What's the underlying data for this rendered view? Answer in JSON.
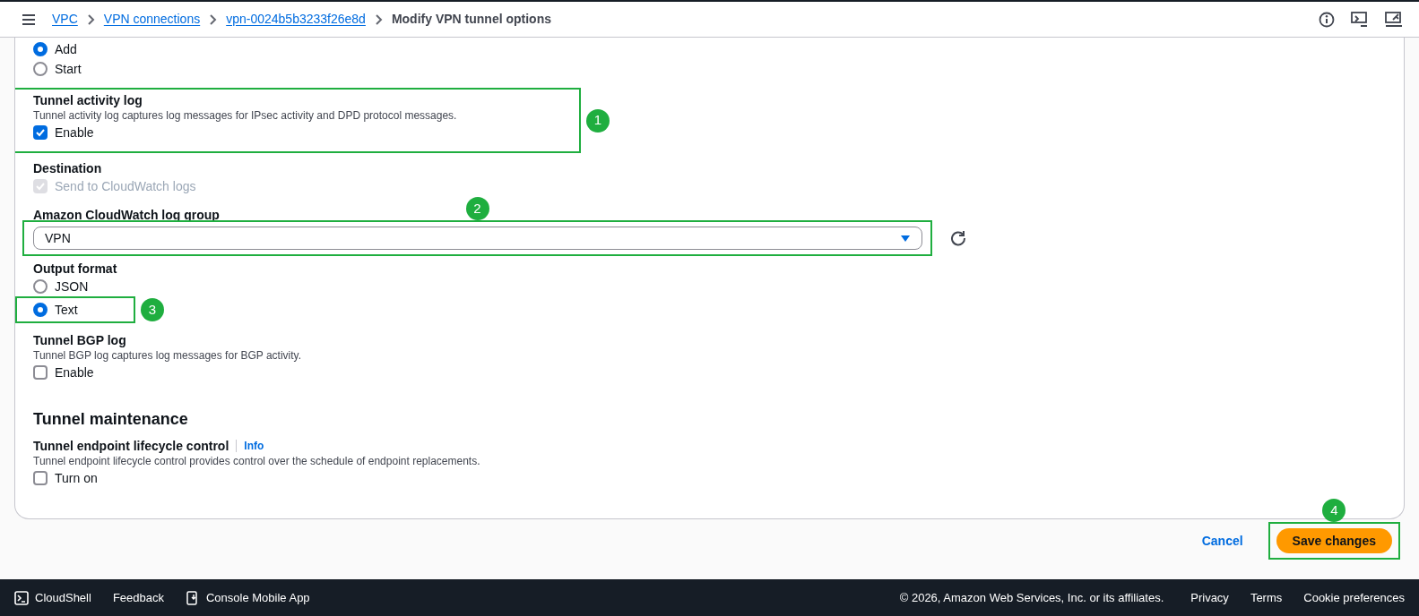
{
  "breadcrumb": [
    {
      "label": "VPC",
      "kind": "link"
    },
    {
      "label": "VPN connections",
      "kind": "link"
    },
    {
      "label": "vpn-0024b5b3233f26e8d",
      "kind": "link"
    },
    {
      "label": "Modify VPN tunnel options",
      "kind": "current"
    }
  ],
  "fields": [
    {
      "kind": "radio",
      "options": [
        {
          "label": "Add",
          "selected": true
        },
        {
          "label": "Start",
          "selected": false
        }
      ]
    },
    {
      "kind": "checkbox",
      "label": "Tunnel activity log",
      "description": "Tunnel activity log captures log messages for IPsec activity and DPD protocol messages.",
      "option": {
        "label": "Enable",
        "checked": true,
        "disabled": false
      },
      "annotation": {
        "number": "1"
      }
    },
    {
      "kind": "checkbox",
      "label": "Destination",
      "option": {
        "label": "Send to CloudWatch logs",
        "checked": true,
        "disabled": true
      }
    },
    {
      "kind": "select",
      "label": "Amazon CloudWatch log group",
      "value": "VPN",
      "annotation": {
        "number": "2"
      }
    },
    {
      "kind": "radio",
      "label": "Output format",
      "options": [
        {
          "label": "JSON",
          "selected": false
        },
        {
          "label": "Text",
          "selected": true,
          "annotation": {
            "number": "3"
          }
        }
      ]
    },
    {
      "kind": "checkbox",
      "label": "Tunnel BGP log",
      "description": "Tunnel BGP log captures log messages for BGP activity.",
      "option": {
        "label": "Enable",
        "checked": false,
        "disabled": false
      }
    },
    {
      "kind": "heading",
      "label": "Tunnel maintenance"
    },
    {
      "kind": "checkbox",
      "label": "Tunnel endpoint lifecycle control",
      "info": "Info",
      "description": "Tunnel endpoint lifecycle control provides control over the schedule of endpoint replacements.",
      "option": {
        "label": "Turn on",
        "checked": false,
        "disabled": false
      }
    }
  ],
  "actions": {
    "cancel": "Cancel",
    "save": {
      "label": "Save changes",
      "annotation": {
        "number": "4"
      }
    }
  },
  "footer": {
    "left": [
      {
        "label": "CloudShell"
      },
      {
        "label": "Feedback"
      },
      {
        "label": "Console Mobile App"
      }
    ],
    "copyright": "© 2026, Amazon Web Services, Inc. or its affiliates.",
    "links": [
      "Privacy",
      "Terms",
      "Cookie preferences"
    ]
  }
}
